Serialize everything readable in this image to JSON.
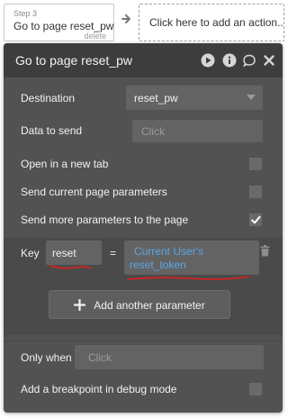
{
  "step": {
    "number_label": "Step 3",
    "title": "Go to page reset_pw",
    "delete_label": "delete"
  },
  "add_action": {
    "label": "Click here to add an action..."
  },
  "panel": {
    "title": "Go to page reset_pw",
    "header_icons": [
      "play-icon",
      "info-icon",
      "comment-icon",
      "close-icon"
    ],
    "destination": {
      "label": "Destination",
      "value": "reset_pw"
    },
    "data_to_send": {
      "label": "Data to send",
      "placeholder": "Click"
    },
    "open_new_tab": {
      "label": "Open in a new tab",
      "checked": false
    },
    "send_current_params": {
      "label": "Send current page parameters",
      "checked": false
    },
    "send_more_params": {
      "label": "Send more parameters to the page",
      "checked": true
    },
    "param": {
      "key_label": "Key",
      "key_value": "reset",
      "equals": "=",
      "value_line1": "Current User's",
      "value_line2": "reset_token"
    },
    "add_param_label": "Add another parameter",
    "only_when": {
      "label": "Only when",
      "placeholder": "Click"
    },
    "breakpoint": {
      "label": "Add a breakpoint in debug mode",
      "checked": false
    }
  },
  "colors": {
    "panel_bg": "#525252",
    "header_bg": "#3d3d3d",
    "field_bg": "#636363",
    "link_blue": "#5aa6e6",
    "annotation_red": "#e0201f"
  }
}
